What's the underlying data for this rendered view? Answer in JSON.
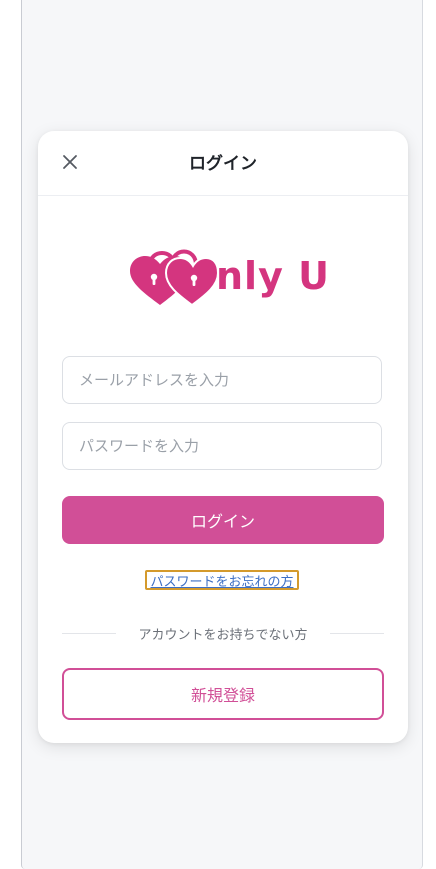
{
  "modal": {
    "title": "ログイン",
    "close_icon": "close-icon"
  },
  "logo": {
    "text": "nly U",
    "icon": "heart-padlocks-icon",
    "color": "#d4357f"
  },
  "form": {
    "email_placeholder": "メールアドレスを入力",
    "email_value": "",
    "password_placeholder": "パスワードを入力",
    "password_value": "",
    "login_label": "ログイン",
    "forgot_label": "パスワードをお忘れの方"
  },
  "divider": {
    "text": "アカウントをお持ちでない方"
  },
  "register": {
    "label": "新規登録"
  },
  "colors": {
    "accent": "#d14f97",
    "link": "#3d6fc4",
    "focus_outline": "#d49a2c"
  }
}
